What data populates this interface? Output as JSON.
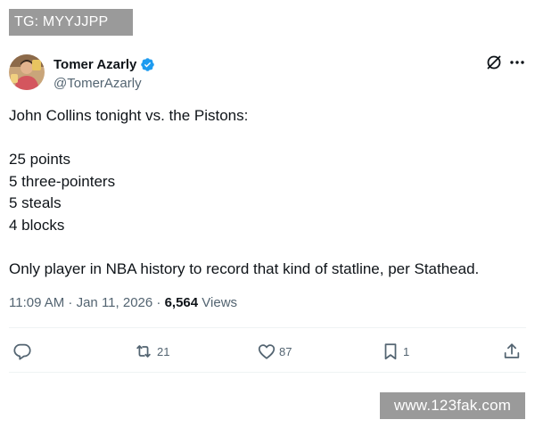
{
  "watermarks": {
    "top": "TG: MYYJJPP",
    "bottom": "www.123fak.com"
  },
  "author": {
    "display_name": "Tomer Azarly",
    "handle": "@TomerAzarly",
    "verified": true,
    "accent_color": "#1d9bf0"
  },
  "tweet": {
    "lines": [
      "John Collins tonight vs. the Pistons:",
      "25 points",
      "5 three-pointers",
      "5 steals",
      "4 blocks",
      "Only player in NBA history to record that kind of statline, per Stathead."
    ],
    "timestamp": "11:09 AM · Jan 11, 2026",
    "separator": " · ",
    "views_count": "6,564",
    "views_label": "Views"
  },
  "actions": {
    "reply_count": "",
    "retweet_count": "21",
    "like_count": "87",
    "bookmark_count": "1"
  },
  "icons": {
    "header": [
      "grok-icon",
      "more-icon"
    ],
    "actions": [
      "reply-icon",
      "retweet-icon",
      "like-icon",
      "bookmark-icon",
      "share-icon"
    ]
  }
}
